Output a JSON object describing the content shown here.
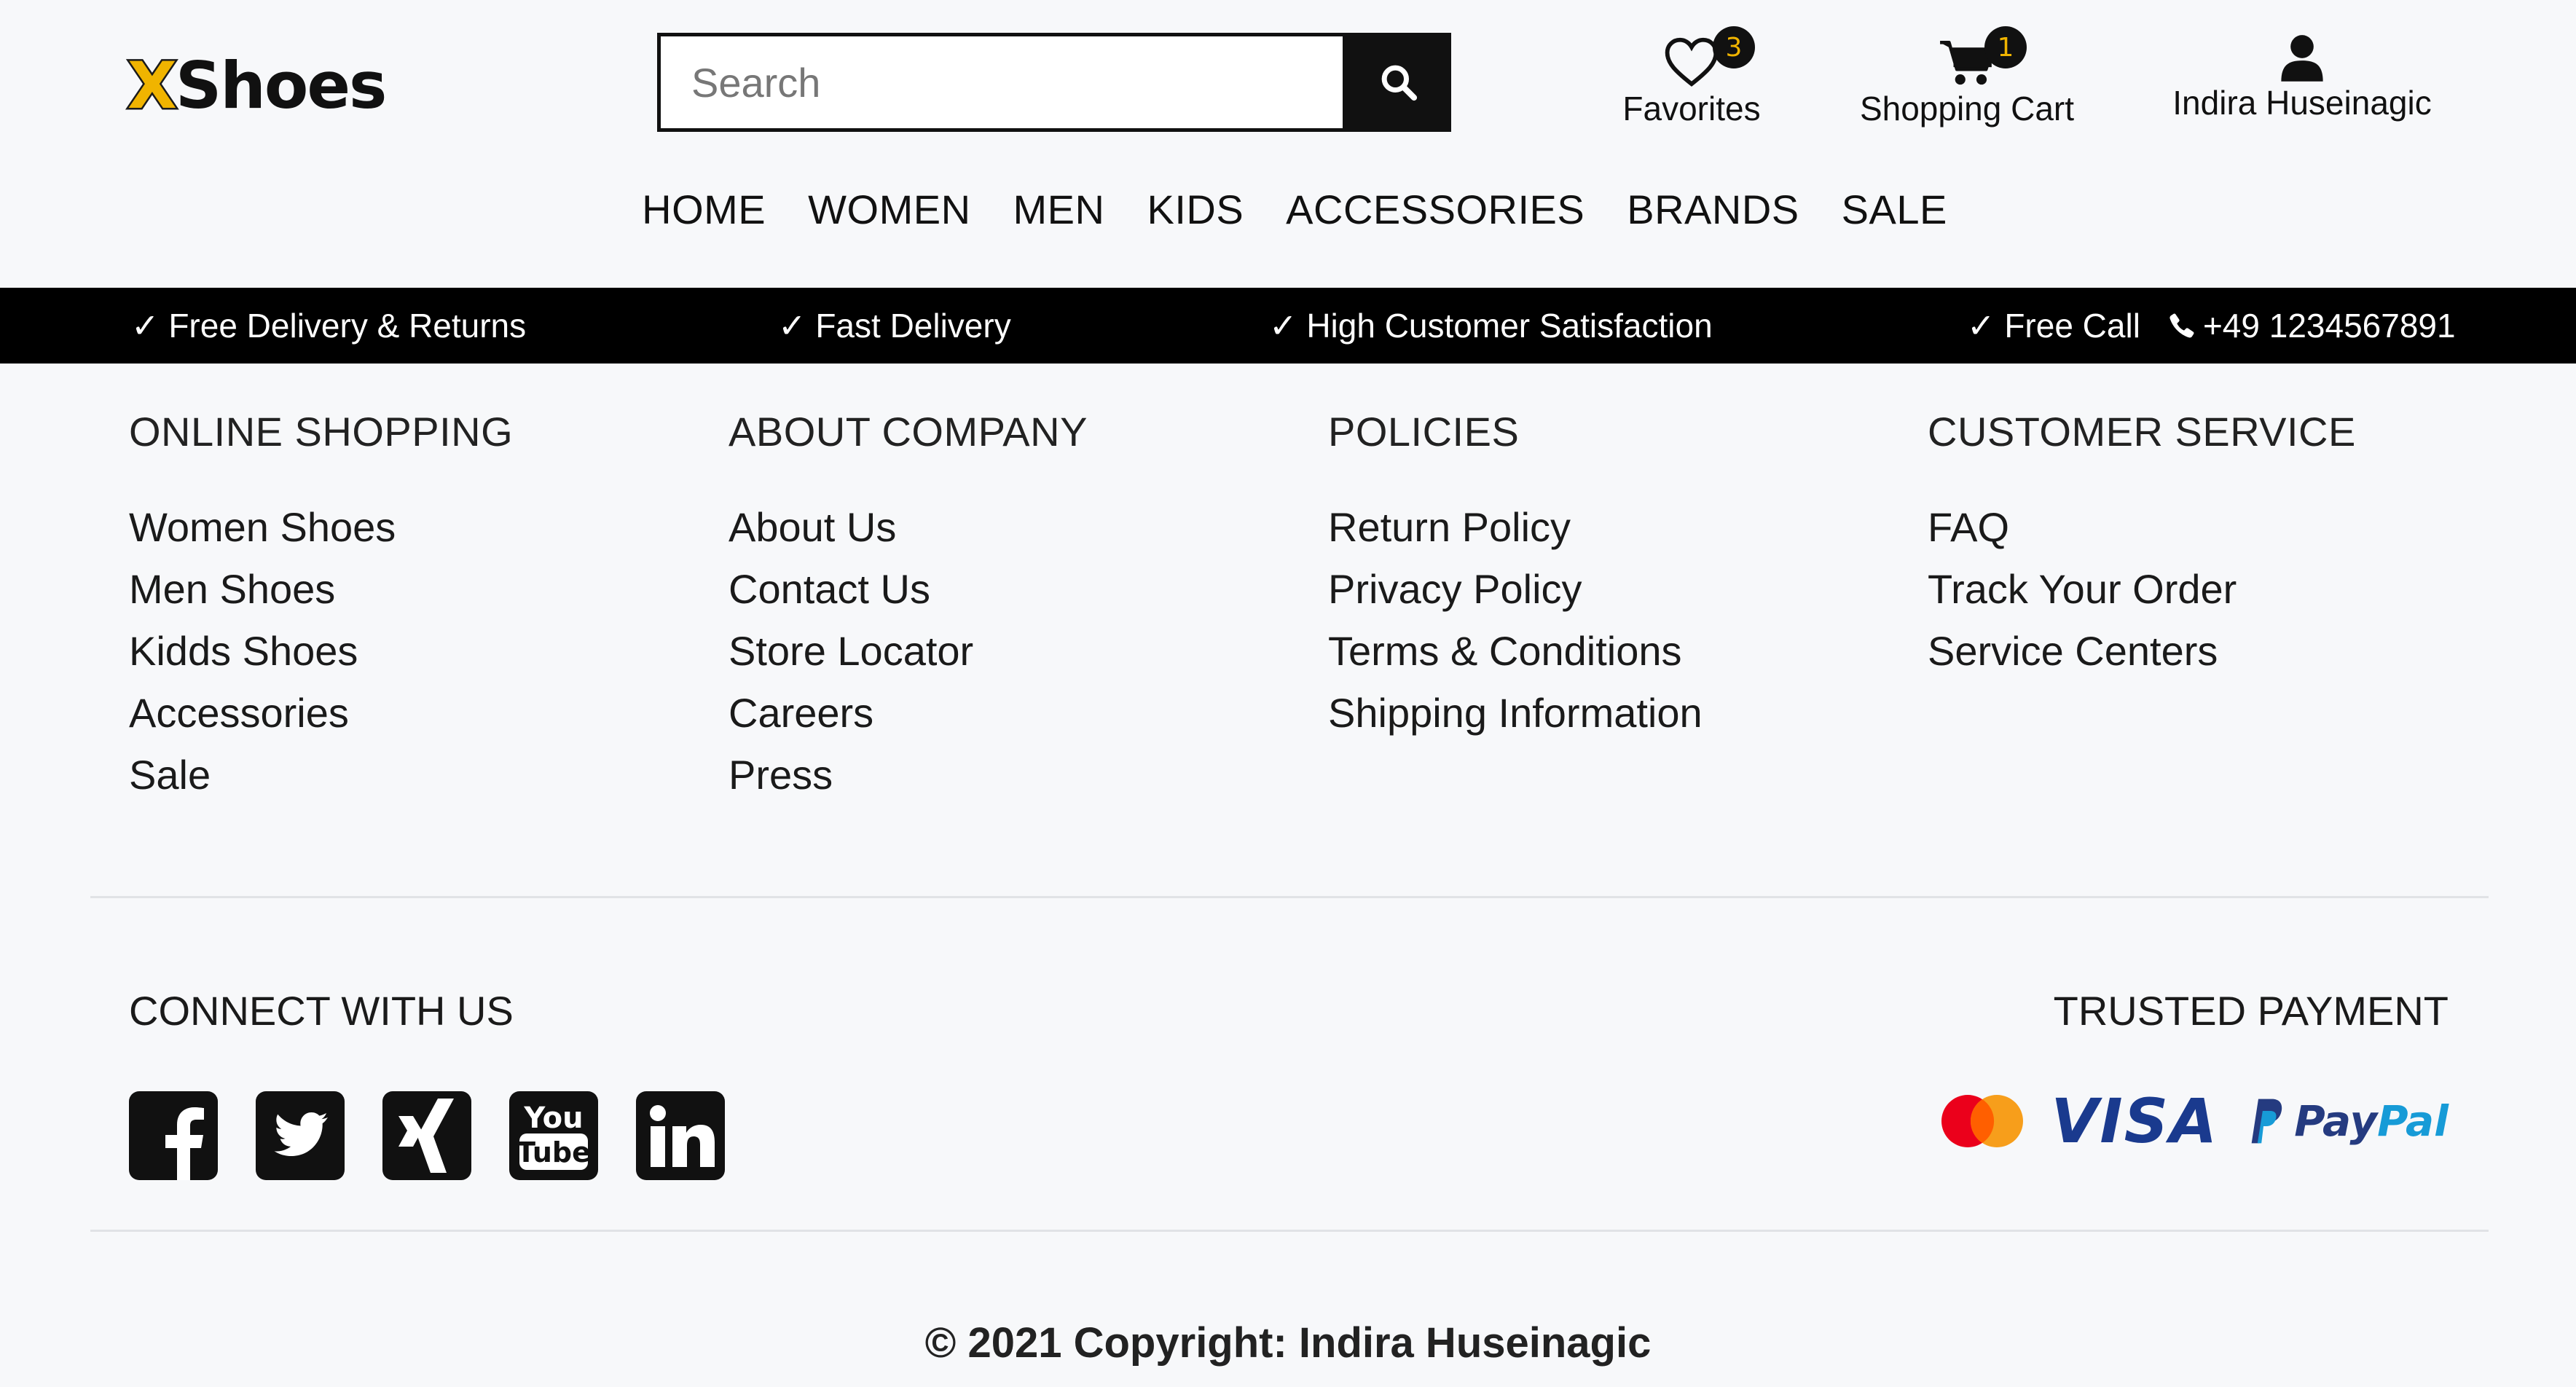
{
  "header": {
    "logo": {
      "x": "X",
      "rest": "Shoes"
    },
    "search": {
      "placeholder": "Search",
      "value": ""
    },
    "favorites": {
      "label": "Favorites",
      "count": "3"
    },
    "cart": {
      "label": "Shopping Cart",
      "count": "1"
    },
    "user": {
      "name": "Indira Huseinagic"
    },
    "nav": [
      "HOME",
      "WOMEN",
      "MEN",
      "KIDS",
      "ACCESSORIES",
      "BRANDS",
      "SALE"
    ]
  },
  "benefits": {
    "free_delivery": "✓ Free Delivery & Returns",
    "fast_delivery": "✓ Fast Delivery",
    "satisfaction": "✓ High Customer Satisfaction",
    "free_call": "✓ Free Call",
    "phone": "+49 1234567891"
  },
  "footer": {
    "columns": [
      {
        "title": "ONLINE SHOPPING",
        "links": [
          "Women Shoes",
          "Men Shoes",
          "Kidds Shoes",
          "Accessories",
          "Sale"
        ]
      },
      {
        "title": "ABOUT COMPANY",
        "links": [
          "About Us",
          "Contact Us",
          "Store Locator",
          "Careers",
          "Press"
        ]
      },
      {
        "title": "POLICIES",
        "links": [
          "Return Policy",
          "Privacy Policy",
          "Terms & Conditions",
          "Shipping Information"
        ]
      },
      {
        "title": "CUSTOMER SERVICE",
        "links": [
          "FAQ",
          "Track Your Order",
          "Service Centers"
        ]
      }
    ],
    "connect_title": "CONNECT WITH US",
    "social": [
      "facebook-icon",
      "twitter-icon",
      "xing-icon",
      "youtube-icon",
      "linkedin-icon"
    ],
    "trusted_title": "TRUSTED PAYMENT",
    "payments": {
      "visa": "VISA",
      "paypal_a": "Pay",
      "paypal_b": "Pal"
    },
    "copyright": "© 2021 Copyright: Indira Huseinagic"
  },
  "colors": {
    "accent": "#f0b400",
    "bar": "#000000",
    "visa": "#1a3a8e",
    "paypal_dark": "#253b80",
    "paypal_light": "#179bd7"
  }
}
